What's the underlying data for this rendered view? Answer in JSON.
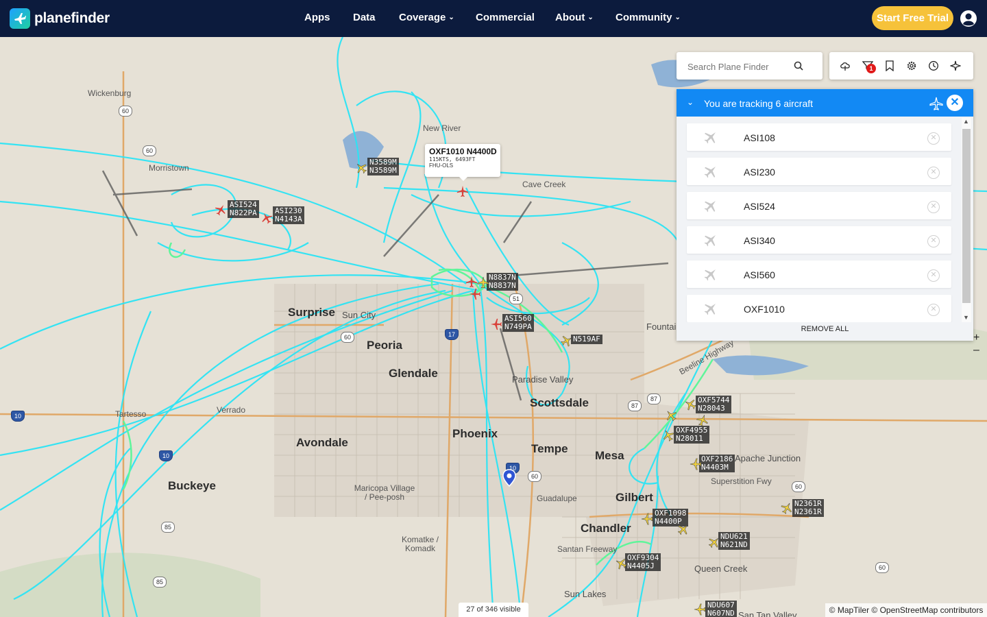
{
  "brand": {
    "name": "planefinder"
  },
  "nav": {
    "items": [
      {
        "label": "Apps",
        "has_caret": false
      },
      {
        "label": "Data",
        "has_caret": false
      },
      {
        "label": "Coverage",
        "has_caret": true
      },
      {
        "label": "Commercial",
        "has_caret": false
      },
      {
        "label": "About",
        "has_caret": true
      },
      {
        "label": "Community",
        "has_caret": true
      }
    ],
    "cta_label": "Start Free Trial"
  },
  "search": {
    "placeholder": "Search Plane Finder"
  },
  "toolbar": {
    "filter_badge": "1"
  },
  "tracking": {
    "title": "You are tracking 6 aircraft",
    "items": [
      "ASI108",
      "ASI230",
      "ASI524",
      "ASI340",
      "ASI560",
      "OXF1010"
    ],
    "remove_all": "REMOVE ALL"
  },
  "popup": {
    "title": "OXF1010 N4400D",
    "stats": "115KTS, 6493FT",
    "route": "FHU-OLS"
  },
  "map": {
    "places_big": [
      "Surprise",
      "Peoria",
      "Glendale",
      "Phoenix",
      "Avondale",
      "Buckeye",
      "Tempe",
      "Mesa",
      "Scottsdale",
      "Gilbert",
      "Chandler"
    ],
    "places_mid": [
      "Sun City",
      "Paradise Valley",
      "Apache Junction",
      "Queen Creek",
      "Sun Lakes",
      "San Tan Valley",
      "Fountain Hills"
    ],
    "places_small": [
      "Wickenburg",
      "Morristown",
      "New River",
      "Cave Creek",
      "Verrado",
      "Tartesso",
      "Maricopa Village / Pee-posh",
      "Komatke / Komadk",
      "Guadalupe",
      "Santan Freeway",
      "Superstition Fwy",
      "Beeline Highway"
    ],
    "aircraft_labels": [
      {
        "callsign": "N3589M",
        "reg": "N3589M"
      },
      {
        "callsign": "ASI524",
        "reg": "N822PA"
      },
      {
        "callsign": "ASI230",
        "reg": "N4143A"
      },
      {
        "callsign": "N8837N",
        "reg": "N8837N"
      },
      {
        "callsign": "ASI560",
        "reg": "N749PA"
      },
      {
        "callsign": "N519AF",
        "reg": ""
      },
      {
        "callsign": "OXF5744",
        "reg": "N28043"
      },
      {
        "callsign": "OXF4955",
        "reg": "N28011"
      },
      {
        "callsign": "OXF2186",
        "reg": "N4403M"
      },
      {
        "callsign": "N2361R",
        "reg": "N2361R"
      },
      {
        "callsign": "OXF1098",
        "reg": "N4400P"
      },
      {
        "callsign": "NDU621",
        "reg": "N621ND"
      },
      {
        "callsign": "OXF9304",
        "reg": "N4405J"
      },
      {
        "callsign": "NDU607",
        "reg": "N607ND"
      }
    ],
    "shields": [
      "60",
      "60",
      "10",
      "10",
      "17",
      "51",
      "60",
      "87",
      "87",
      "60",
      "10",
      "85",
      "85",
      "60",
      "60"
    ],
    "visible_count": "27 of 346 visible",
    "attribution": "© MapTiler © OpenStreetMap contributors",
    "colors": {
      "track_primary": "#2be4f5",
      "track_low": "#5ff59a",
      "plane_red": "#d9413a",
      "plane_yellow": "#f2d23c"
    }
  }
}
